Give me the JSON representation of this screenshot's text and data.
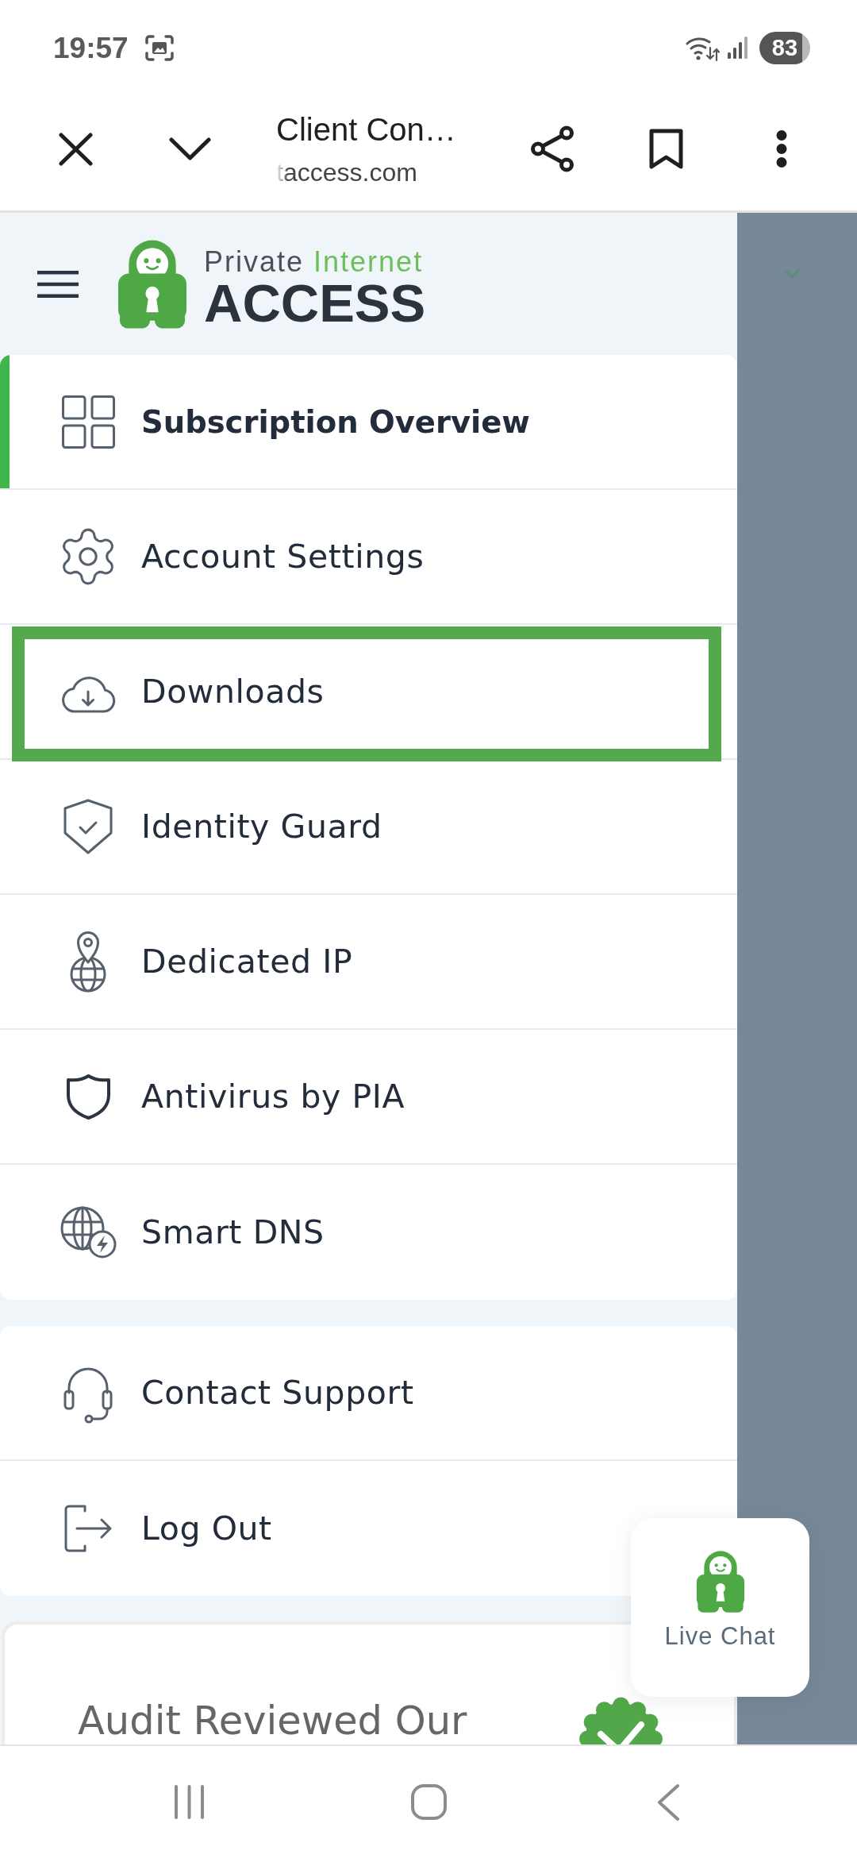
{
  "status_bar": {
    "time": "19:57",
    "battery": "83"
  },
  "browser_bar": {
    "title": "Client Con…",
    "url": "taccess.com"
  },
  "sidebar": {
    "logo": {
      "top": "Private",
      "accent": "Internet",
      "main": "ACCESS"
    },
    "menu_groups": [
      {
        "items": [
          {
            "label": "Subscription Overview",
            "selected": true,
            "highlighted": false
          },
          {
            "label": "Account Settings",
            "selected": false,
            "highlighted": false
          },
          {
            "label": "Downloads",
            "selected": false,
            "highlighted": true
          },
          {
            "label": "Identity Guard",
            "selected": false,
            "highlighted": false
          },
          {
            "label": "Dedicated IP",
            "selected": false,
            "highlighted": false
          },
          {
            "label": "Antivirus by PIA",
            "selected": false,
            "highlighted": false
          },
          {
            "label": "Smart DNS",
            "selected": false,
            "highlighted": false
          }
        ]
      },
      {
        "items": [
          {
            "label": "Contact Support",
            "selected": false,
            "highlighted": false
          },
          {
            "label": "Log Out",
            "selected": false,
            "highlighted": false
          }
        ]
      }
    ],
    "audit_card": {
      "heading": "Audit Reviewed Our"
    }
  },
  "live_chat": {
    "label": "Live Chat"
  }
}
